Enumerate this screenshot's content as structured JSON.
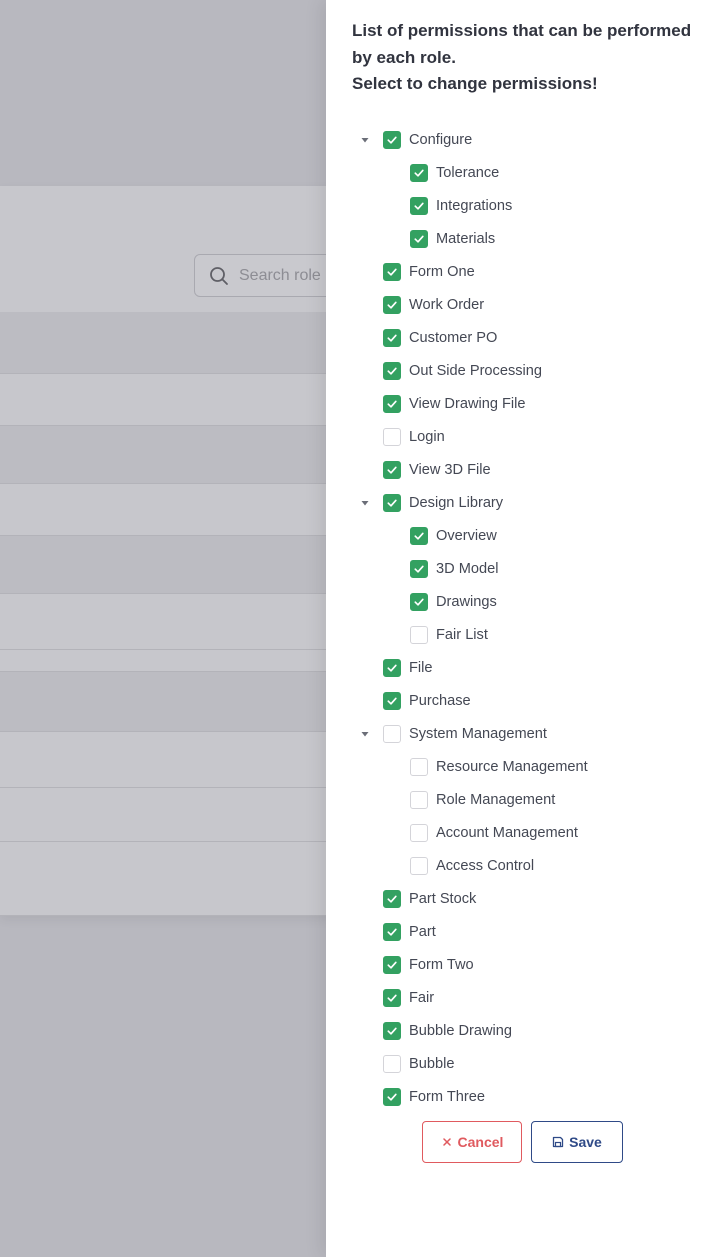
{
  "background": {
    "search_placeholder": "Search role"
  },
  "drawer": {
    "title_lines": [
      "List of permissions that can be performed",
      "by each role.",
      "Select to change permissions!"
    ],
    "tree": [
      {
        "label": "Configure",
        "checked": true,
        "level": 0,
        "expanded": true
      },
      {
        "label": "Tolerance",
        "checked": true,
        "level": 1
      },
      {
        "label": "Integrations",
        "checked": true,
        "level": 1
      },
      {
        "label": "Materials",
        "checked": true,
        "level": 1
      },
      {
        "label": "Form One",
        "checked": true,
        "level": 0
      },
      {
        "label": "Work Order",
        "checked": true,
        "level": 0
      },
      {
        "label": "Customer PO",
        "checked": true,
        "level": 0
      },
      {
        "label": "Out Side Processing",
        "checked": true,
        "level": 0
      },
      {
        "label": "View Drawing File",
        "checked": true,
        "level": 0
      },
      {
        "label": "Login",
        "checked": false,
        "level": 0
      },
      {
        "label": "View 3D File",
        "checked": true,
        "level": 0
      },
      {
        "label": "Design Library",
        "checked": true,
        "level": 0,
        "expanded": true
      },
      {
        "label": "Overview",
        "checked": true,
        "level": 1
      },
      {
        "label": "3D Model",
        "checked": true,
        "level": 1
      },
      {
        "label": "Drawings",
        "checked": true,
        "level": 1
      },
      {
        "label": "Fair List",
        "checked": false,
        "level": 1
      },
      {
        "label": "File",
        "checked": true,
        "level": 0
      },
      {
        "label": "Purchase",
        "checked": true,
        "level": 0
      },
      {
        "label": "System Management",
        "checked": false,
        "level": 0,
        "expanded": true
      },
      {
        "label": "Resource Management",
        "checked": false,
        "level": 1
      },
      {
        "label": "Role Management",
        "checked": false,
        "level": 1
      },
      {
        "label": "Account Management",
        "checked": false,
        "level": 1
      },
      {
        "label": "Access Control",
        "checked": false,
        "level": 1
      },
      {
        "label": "Part Stock",
        "checked": true,
        "level": 0
      },
      {
        "label": "Part",
        "checked": true,
        "level": 0
      },
      {
        "label": "Form Two",
        "checked": true,
        "level": 0
      },
      {
        "label": "Fair",
        "checked": true,
        "level": 0
      },
      {
        "label": "Bubble Drawing",
        "checked": true,
        "level": 0
      },
      {
        "label": "Bubble",
        "checked": false,
        "level": 0
      },
      {
        "label": "Form Three",
        "checked": true,
        "level": 0
      }
    ],
    "buttons": {
      "cancel_label": "Cancel",
      "save_label": "Save"
    }
  },
  "colors": {
    "checked": "#33a161",
    "cancel": "#e05a5f",
    "save": "#2f4a87"
  },
  "icons": {
    "search": "search-icon",
    "caret": "caret-down-icon",
    "check": "check-icon",
    "close": "close-icon",
    "save": "save-icon"
  }
}
